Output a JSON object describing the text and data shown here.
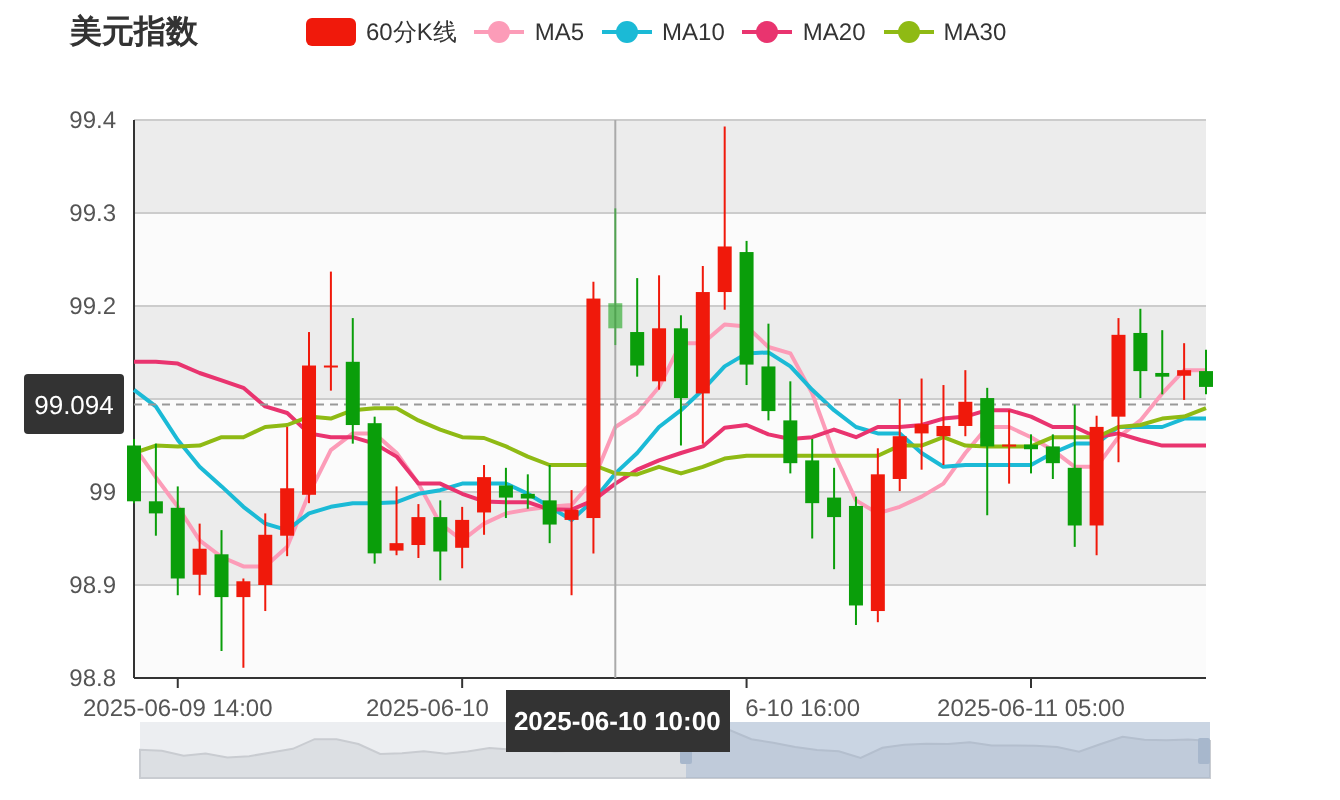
{
  "title": "美元指数",
  "chart": {
    "legend": {
      "candle_label": "60分K线"
    },
    "chart_data": {
      "type": "candlestick",
      "categories": [
        null,
        null,
        "2025-06-09 14:00",
        null,
        null,
        null,
        null,
        null,
        null,
        null,
        null,
        null,
        null,
        null,
        null,
        null,
        null,
        null,
        null,
        null,
        null,
        null,
        "2025-06-10 10:00",
        null,
        null,
        null,
        null,
        null,
        null,
        null,
        null,
        null,
        null,
        null,
        null,
        null,
        null,
        null,
        null,
        null,
        null,
        "2025-06-11 05:00",
        null,
        null,
        null,
        null,
        null,
        null,
        null,
        null
      ],
      "ohlc": [
        [
          99.05,
          99.057,
          98.988,
          98.99
        ],
        [
          98.99,
          99.052,
          98.953,
          98.977
        ],
        [
          98.983,
          99.006,
          98.889,
          98.907
        ],
        [
          98.911,
          98.966,
          98.889,
          98.939
        ],
        [
          98.933,
          98.959,
          98.829,
          98.887
        ],
        [
          98.887,
          98.907,
          98.811,
          98.904
        ],
        [
          98.9,
          98.977,
          98.872,
          98.954
        ],
        [
          98.953,
          99.07,
          98.931,
          99.004
        ],
        [
          98.997,
          99.172,
          98.988,
          99.136
        ],
        [
          99.134,
          99.237,
          99.109,
          99.136
        ],
        [
          99.14,
          99.187,
          99.052,
          99.072
        ],
        [
          99.074,
          99.081,
          98.923,
          98.934
        ],
        [
          98.937,
          99.006,
          98.932,
          98.945
        ],
        [
          98.943,
          98.987,
          98.929,
          98.973
        ],
        [
          98.973,
          98.991,
          98.905,
          98.936
        ],
        [
          98.94,
          98.984,
          98.918,
          98.97
        ],
        [
          98.978,
          99.029,
          98.954,
          99.016
        ],
        [
          99.007,
          99.026,
          98.972,
          98.994
        ],
        [
          98.998,
          99.019,
          98.982,
          98.993
        ],
        [
          98.991,
          99.029,
          98.945,
          98.965
        ],
        [
          98.97,
          99.002,
          98.889,
          98.981
        ],
        [
          98.972,
          99.226,
          98.934,
          99.208
        ],
        [
          99.203,
          99.305,
          99.158,
          99.176
        ],
        [
          99.172,
          99.23,
          99.124,
          99.136
        ],
        [
          99.119,
          99.233,
          99.11,
          99.176
        ],
        [
          99.176,
          99.19,
          99.05,
          99.101
        ],
        [
          99.106,
          99.243,
          99.052,
          99.215
        ],
        [
          99.215,
          99.393,
          99.196,
          99.264
        ],
        [
          99.258,
          99.27,
          99.115,
          99.137
        ],
        [
          99.135,
          99.181,
          99.077,
          99.087
        ],
        [
          99.077,
          99.119,
          99.02,
          99.031
        ],
        [
          99.034,
          99.057,
          98.95,
          98.988
        ],
        [
          98.994,
          99.026,
          98.917,
          98.973
        ],
        [
          98.985,
          98.995,
          98.857,
          98.878
        ],
        [
          98.872,
          99.047,
          98.86,
          99.019
        ],
        [
          99.014,
          99.1,
          99.001,
          99.06
        ],
        [
          99.063,
          99.122,
          99.024,
          99.073
        ],
        [
          99.06,
          99.115,
          99.029,
          99.071
        ],
        [
          99.071,
          99.131,
          99.06,
          99.097
        ],
        [
          99.101,
          99.112,
          98.975,
          99.049
        ],
        [
          99.049,
          99.088,
          99.009,
          99.051
        ],
        [
          99.051,
          99.062,
          99.02,
          99.046
        ],
        [
          99.049,
          99.062,
          99.014,
          99.031
        ],
        [
          99.026,
          99.094,
          98.941,
          98.964
        ],
        [
          98.964,
          99.082,
          98.932,
          99.07
        ],
        [
          99.081,
          99.187,
          99.032,
          99.169
        ],
        [
          99.171,
          99.197,
          99.101,
          99.13
        ],
        [
          99.128,
          99.174,
          99.105,
          99.124
        ],
        [
          99.125,
          99.16,
          99.099,
          99.131
        ],
        [
          99.13,
          99.153,
          99.105,
          99.113
        ]
      ],
      "series": [
        {
          "name": "MA5",
          "type": "line",
          "color": "#fc9cb8",
          "values": [
            99.049,
            99.016,
            98.984,
            98.948,
            98.93,
            98.92,
            98.92,
            98.941,
            98.998,
            99.045,
            99.063,
            99.063,
            99.042,
            99.009,
            98.966,
            98.948,
            98.966,
            98.977,
            98.981,
            98.984,
            98.986,
            99.013,
            99.07,
            99.085,
            99.113,
            99.16,
            99.16,
            99.18,
            99.178,
            99.156,
            99.149,
            99.106,
            99.042,
            98.991,
            98.977,
            98.984,
            98.995,
            99.009,
            99.042,
            99.07,
            99.07,
            99.059,
            99.045,
            99.027,
            99.027,
            99.059,
            99.077,
            99.106,
            99.131,
            99.131
          ]
        },
        {
          "name": "MA10",
          "type": "line",
          "color": "#1bbad6",
          "values": [
            99.11,
            99.092,
            99.056,
            99.027,
            99.006,
            98.984,
            98.966,
            98.959,
            98.977,
            98.984,
            98.988,
            98.988,
            98.989,
            98.998,
            99.002,
            99.009,
            99.009,
            99.009,
            98.998,
            98.984,
            98.97,
            98.991,
            99.02,
            99.042,
            99.07,
            99.088,
            99.11,
            99.135,
            99.149,
            99.15,
            99.135,
            99.11,
            99.088,
            99.07,
            99.063,
            99.063,
            99.042,
            99.027,
            99.029,
            99.029,
            99.029,
            99.029,
            99.042,
            99.052,
            99.052,
            99.07,
            99.07,
            99.07,
            99.079,
            99.079
          ]
        },
        {
          "name": "MA20",
          "type": "line",
          "color": "#e9346f",
          "values": [
            99.14,
            99.14,
            99.138,
            99.128,
            99.12,
            99.112,
            99.092,
            99.085,
            99.063,
            99.059,
            99.059,
            99.052,
            99.038,
            99.009,
            99.009,
            98.998,
            98.99,
            98.989,
            98.989,
            98.981,
            98.981,
            98.991,
            99.009,
            99.024,
            99.034,
            99.042,
            99.049,
            99.069,
            99.072,
            99.062,
            99.057,
            99.059,
            99.067,
            99.059,
            99.07,
            99.07,
            99.072,
            99.079,
            99.081,
            99.088,
            99.088,
            99.081,
            99.07,
            99.07,
            99.059,
            99.063,
            99.056,
            99.05,
            99.05,
            99.05
          ]
        },
        {
          "name": "MA30",
          "type": "line",
          "color": "#8fba14",
          "values": [
            99.042,
            99.05,
            99.049,
            99.05,
            99.059,
            99.059,
            99.07,
            99.072,
            99.081,
            99.079,
            99.088,
            99.09,
            99.09,
            99.077,
            99.067,
            99.059,
            99.058,
            99.049,
            99.038,
            99.029,
            99.029,
            99.029,
            99.02,
            99.019,
            99.027,
            99.02,
            99.027,
            99.036,
            99.039,
            99.039,
            99.039,
            99.039,
            99.039,
            99.039,
            99.039,
            99.05,
            99.05,
            99.059,
            99.05,
            99.049,
            99.049,
            99.049,
            99.059,
            99.059,
            99.059,
            99.07,
            99.072,
            99.079,
            99.081,
            99.09
          ]
        }
      ],
      "ylim": [
        98.8,
        99.4
      ],
      "yticks": [
        98.8,
        98.9,
        99,
        99.2,
        99.3,
        99.4
      ],
      "grid": true,
      "bands": [
        {
          "axis": "y",
          "from": 99.3,
          "to": 99.4
        },
        {
          "axis": "y",
          "from": 99.1,
          "to": 99.2
        },
        {
          "axis": "y",
          "from": 98.9,
          "to": 99
        }
      ],
      "ref_lines": [
        {
          "axis": "y",
          "value": 99.094,
          "label": "99.094"
        },
        {
          "axis": "x",
          "value": "2025-06-10 10:00"
        }
      ]
    },
    "covered_axis_labels": [
      "2025-06-10",
      "6-10 16:00"
    ]
  }
}
